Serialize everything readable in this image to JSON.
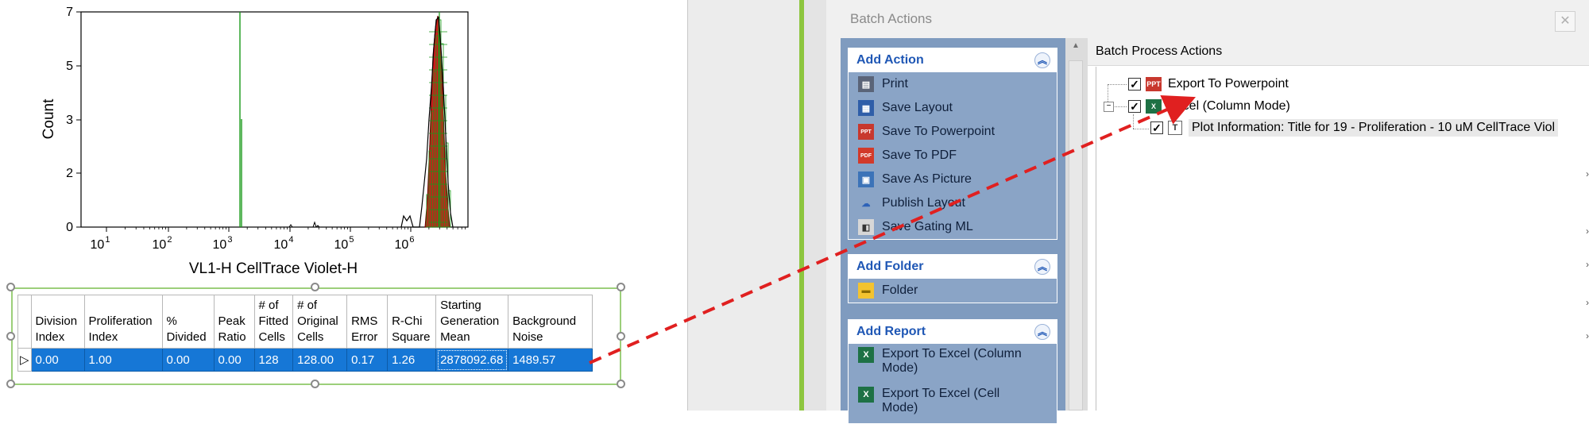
{
  "histogram": {
    "y_ticks": [
      "7",
      "5",
      "3",
      "2",
      "0"
    ],
    "x_ticks": [
      {
        "base": "10",
        "exp": "1"
      },
      {
        "base": "10",
        "exp": "2"
      },
      {
        "base": "10",
        "exp": "3"
      },
      {
        "base": "10",
        "exp": "4"
      },
      {
        "base": "10",
        "exp": "5"
      },
      {
        "base": "10",
        "exp": "6"
      }
    ],
    "ylabel": "Count",
    "xlabel": "VL1-H CellTrace Violet-H",
    "colors": {
      "model": "#1a9a1a",
      "fit": "#cc1b1b",
      "data": "#000000"
    }
  },
  "stats_table": {
    "headers": [
      [
        "Division",
        "Index"
      ],
      [
        "Proliferation",
        "Index"
      ],
      [
        "%",
        "Divided"
      ],
      [
        "Peak",
        "Ratio"
      ],
      [
        "# of",
        "Fitted",
        "Cells"
      ],
      [
        "# of",
        "Original",
        "Cells"
      ],
      [
        "RMS",
        "Error"
      ],
      [
        "R-Chi",
        "Square"
      ],
      [
        "Starting",
        "Generation",
        "Mean"
      ],
      [
        "Background",
        "Noise"
      ]
    ],
    "row": [
      "0.00",
      "1.00",
      "0.00",
      "0.00",
      "128",
      "128.00",
      "0.17",
      "1.26",
      "2878092.68",
      "1489.57"
    ],
    "row_marker": "▷"
  },
  "batch_window": {
    "title": "Batch Actions",
    "close_glyph": "✕",
    "groups": [
      {
        "title": "Add Action",
        "items": [
          {
            "label": "Print",
            "icon": "printer-icon"
          },
          {
            "label": "Save Layout",
            "icon": "save-layout-icon"
          },
          {
            "label": "Save To Powerpoint",
            "icon": "powerpoint-icon"
          },
          {
            "label": "Save To PDF",
            "icon": "pdf-icon"
          },
          {
            "label": "Save As Picture",
            "icon": "picture-icon"
          },
          {
            "label": "Publish Layout",
            "icon": "cloud-upload-icon"
          },
          {
            "label": "Save Gating ML",
            "icon": "xml-icon"
          }
        ]
      },
      {
        "title": "Add Folder",
        "items": [
          {
            "label": "Folder",
            "icon": "folder-icon"
          }
        ]
      },
      {
        "title": "Add Report",
        "items": [
          {
            "label": "Export To Excel (Column Mode)",
            "icon": "excel-icon"
          },
          {
            "label": "Export To Excel (Cell Mode)",
            "icon": "excel-icon"
          }
        ]
      }
    ],
    "right_header": "Batch Process Actions",
    "tree": [
      {
        "label": "Export To Powerpoint",
        "checked": true,
        "icon": "powerpoint-icon"
      },
      {
        "label": "Excel (Column Mode)",
        "checked": true,
        "icon": "excel-icon",
        "expanded": true
      },
      {
        "label": "Plot Information: Title for 19 - Proliferation - 10 uM CellTrace Viol",
        "checked": true,
        "icon": "text-icon"
      }
    ],
    "check_glyph": "✓",
    "collapse_glyph": "−"
  },
  "annotation_arrow_color": "#e02020"
}
